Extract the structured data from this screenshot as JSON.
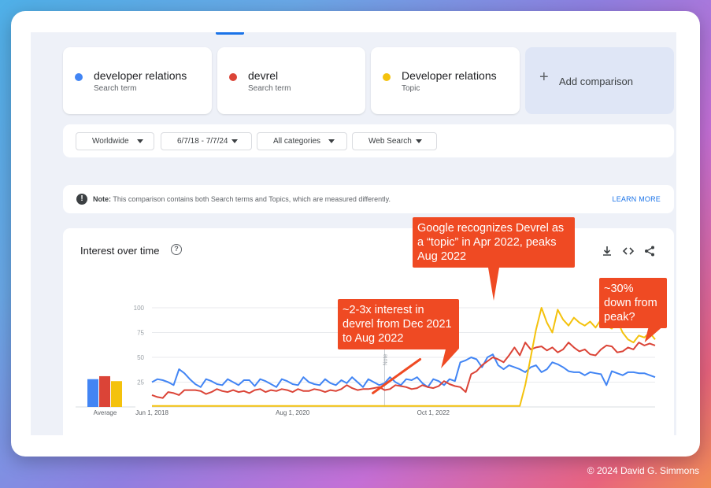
{
  "search_terms": [
    {
      "name": "developer relations",
      "kind": "Search term",
      "color": "#4285f4"
    },
    {
      "name": "devrel",
      "kind": "Search term",
      "color": "#db4437"
    },
    {
      "name": "Developer relations",
      "kind": "Topic",
      "color": "#f4c20d"
    }
  ],
  "add_comparison": {
    "icon": "plus-icon",
    "label": "Add comparison"
  },
  "filters": {
    "region": "Worldwide",
    "date_range": "6/7/18 - 7/7/24",
    "category": "All categories",
    "search_type": "Web Search"
  },
  "note": {
    "label": "Note:",
    "text": "This comparison contains both Search terms and Topics, which are measured differently.",
    "link": "LEARN MORE"
  },
  "interest_panel": {
    "title": "Interest over time",
    "help_icon": "question-mark-icon",
    "tools": [
      "download-icon",
      "embed-code-icon",
      "share-icon"
    ],
    "average_label": "Average",
    "note_marker": "Note"
  },
  "callouts": {
    "topic": "Google recognizes Devrel as a “topic” in Apr 2022, peaks Aug 2022",
    "interest": "~2-3x interest in devrel from Dec 2021 to Aug 2022",
    "peak": "~30% down from peak?"
  },
  "credit": "© 2024 David G. Simmons",
  "chart_data": {
    "type": "line",
    "x_start": "2018-06",
    "x_step": "month",
    "x_ticks": [
      "Jun 1, 2018",
      "Aug 1, 2020",
      "Oct 1, 2022"
    ],
    "y_ticks": [
      25,
      50,
      75,
      100
    ],
    "ylim": [
      0,
      100
    ],
    "grid": true,
    "note_marker_date": "2022-01",
    "averages": {
      "developer relations": 28,
      "devrel": 31,
      "Developer relations": 26
    },
    "series": [
      {
        "name": "developer relations",
        "color": "#4285f4",
        "values": [
          25,
          28,
          27,
          25,
          22,
          38,
          34,
          28,
          23,
          20,
          28,
          26,
          23,
          22,
          28,
          25,
          22,
          27,
          27,
          21,
          28,
          26,
          23,
          20,
          28,
          26,
          23,
          22,
          30,
          25,
          23,
          22,
          28,
          24,
          22,
          27,
          24,
          30,
          25,
          20,
          28,
          25,
          22,
          24,
          30,
          25,
          22,
          28,
          27,
          30,
          24,
          20,
          28,
          26,
          22,
          28,
          26,
          45,
          47,
          50,
          48,
          40,
          50,
          53,
          42,
          38,
          42,
          40,
          38,
          35,
          40,
          42,
          35,
          38,
          45,
          43,
          40,
          36,
          35,
          35,
          32,
          35,
          34,
          33,
          22,
          36,
          34,
          32,
          35,
          35,
          34,
          34,
          32,
          30
        ]
      },
      {
        "name": "devrel",
        "color": "#db4437",
        "values": [
          12,
          10,
          9,
          15,
          14,
          12,
          17,
          17,
          17,
          16,
          13,
          15,
          18,
          16,
          15,
          17,
          15,
          16,
          14,
          17,
          18,
          15,
          17,
          16,
          18,
          17,
          15,
          18,
          16,
          16,
          18,
          17,
          15,
          17,
          16,
          18,
          22,
          19,
          17,
          18,
          18,
          19,
          20,
          17,
          18,
          22,
          21,
          20,
          18,
          19,
          22,
          20,
          19,
          21,
          26,
          23,
          21,
          20,
          15,
          33,
          36,
          42,
          46,
          50,
          48,
          45,
          52,
          60,
          52,
          65,
          58,
          60,
          61,
          57,
          60,
          55,
          58,
          65,
          60,
          56,
          58,
          53,
          52,
          58,
          62,
          61,
          55,
          56,
          60,
          58,
          65,
          62,
          64,
          62
        ]
      },
      {
        "name": "Developer relations",
        "color": "#f4c20d",
        "values": [
          1,
          1,
          1,
          1,
          1,
          1,
          1,
          1,
          1,
          1,
          1,
          1,
          1,
          1,
          1,
          1,
          1,
          1,
          1,
          1,
          1,
          1,
          1,
          1,
          1,
          1,
          1,
          1,
          1,
          1,
          1,
          1,
          1,
          1,
          1,
          1,
          1,
          1,
          1,
          1,
          1,
          1,
          1,
          1,
          1,
          1,
          1,
          1,
          1,
          1,
          1,
          1,
          1,
          1,
          1,
          1,
          1,
          1,
          1,
          1,
          1,
          1,
          1,
          1,
          1,
          1,
          1,
          1,
          1,
          22,
          50,
          78,
          100,
          85,
          75,
          98,
          88,
          82,
          90,
          85,
          82,
          86,
          80,
          88,
          82,
          79,
          87,
          75,
          68,
          65,
          72,
          70,
          75,
          68
        ]
      }
    ]
  }
}
